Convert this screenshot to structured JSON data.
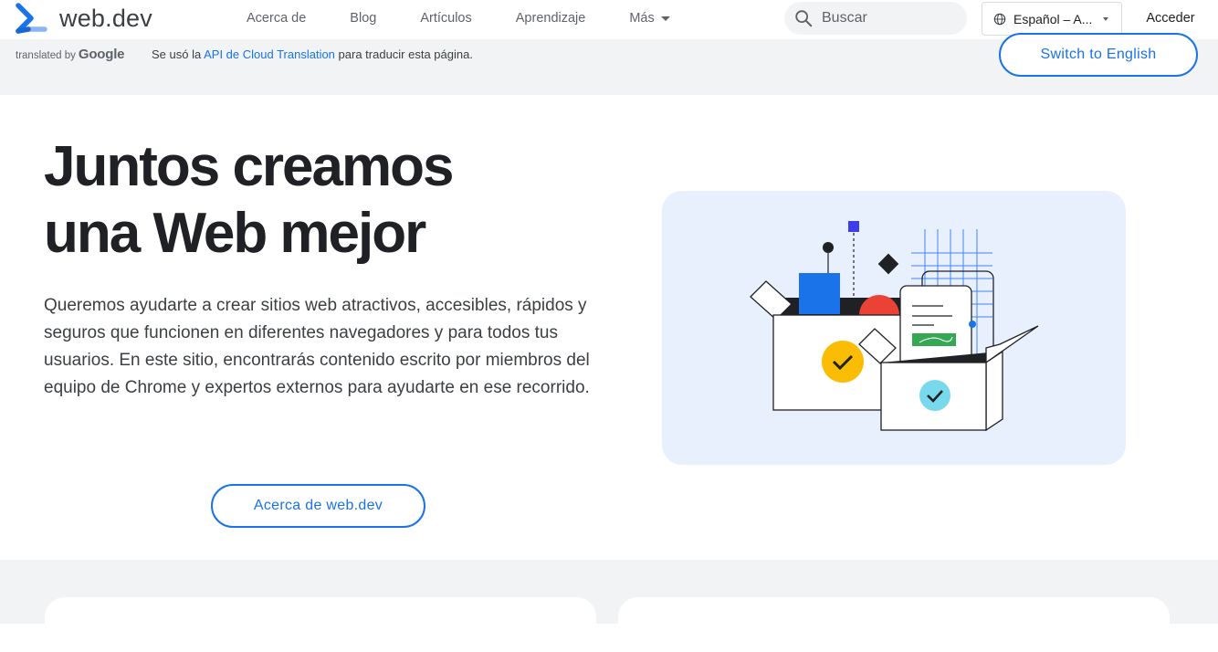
{
  "site": {
    "name": "web.dev"
  },
  "nav": {
    "items": [
      {
        "label": "Acerca de"
      },
      {
        "label": "Blog"
      },
      {
        "label": "Artículos"
      },
      {
        "label": "Aprendizaje"
      },
      {
        "label": "Más"
      }
    ]
  },
  "search": {
    "placeholder": "Buscar"
  },
  "language": {
    "selected": "Español – A..."
  },
  "signin": {
    "label": "Acceder"
  },
  "translation": {
    "translated_by": "translated by",
    "google": "Google",
    "message_before": "Se usó la ",
    "link": "API de Cloud Translation",
    "message_after": " para traducir esta página.",
    "switch_label": "Switch to English"
  },
  "hero": {
    "title_line1": "Juntos creamos",
    "title_line2": "una Web mejor",
    "description": "Queremos ayudarte a crear sitios web atractivos, accesibles, rápidos y seguros que funcionen en diferentes navegadores y para todos tus usuarios. En este sitio, encontrarás contenido escrito por miembros del equipo de Chrome y expertos externos para ayudarte en ese recorrido.",
    "button": "Acerca de web.dev"
  },
  "colors": {
    "accent": "#1a73e8",
    "illustration_bg": "#e8f0fe",
    "yellow": "#fbbc04",
    "red": "#ea4335",
    "blue": "#1a73e8",
    "green": "#34a853",
    "cyan": "#78d9ec"
  }
}
